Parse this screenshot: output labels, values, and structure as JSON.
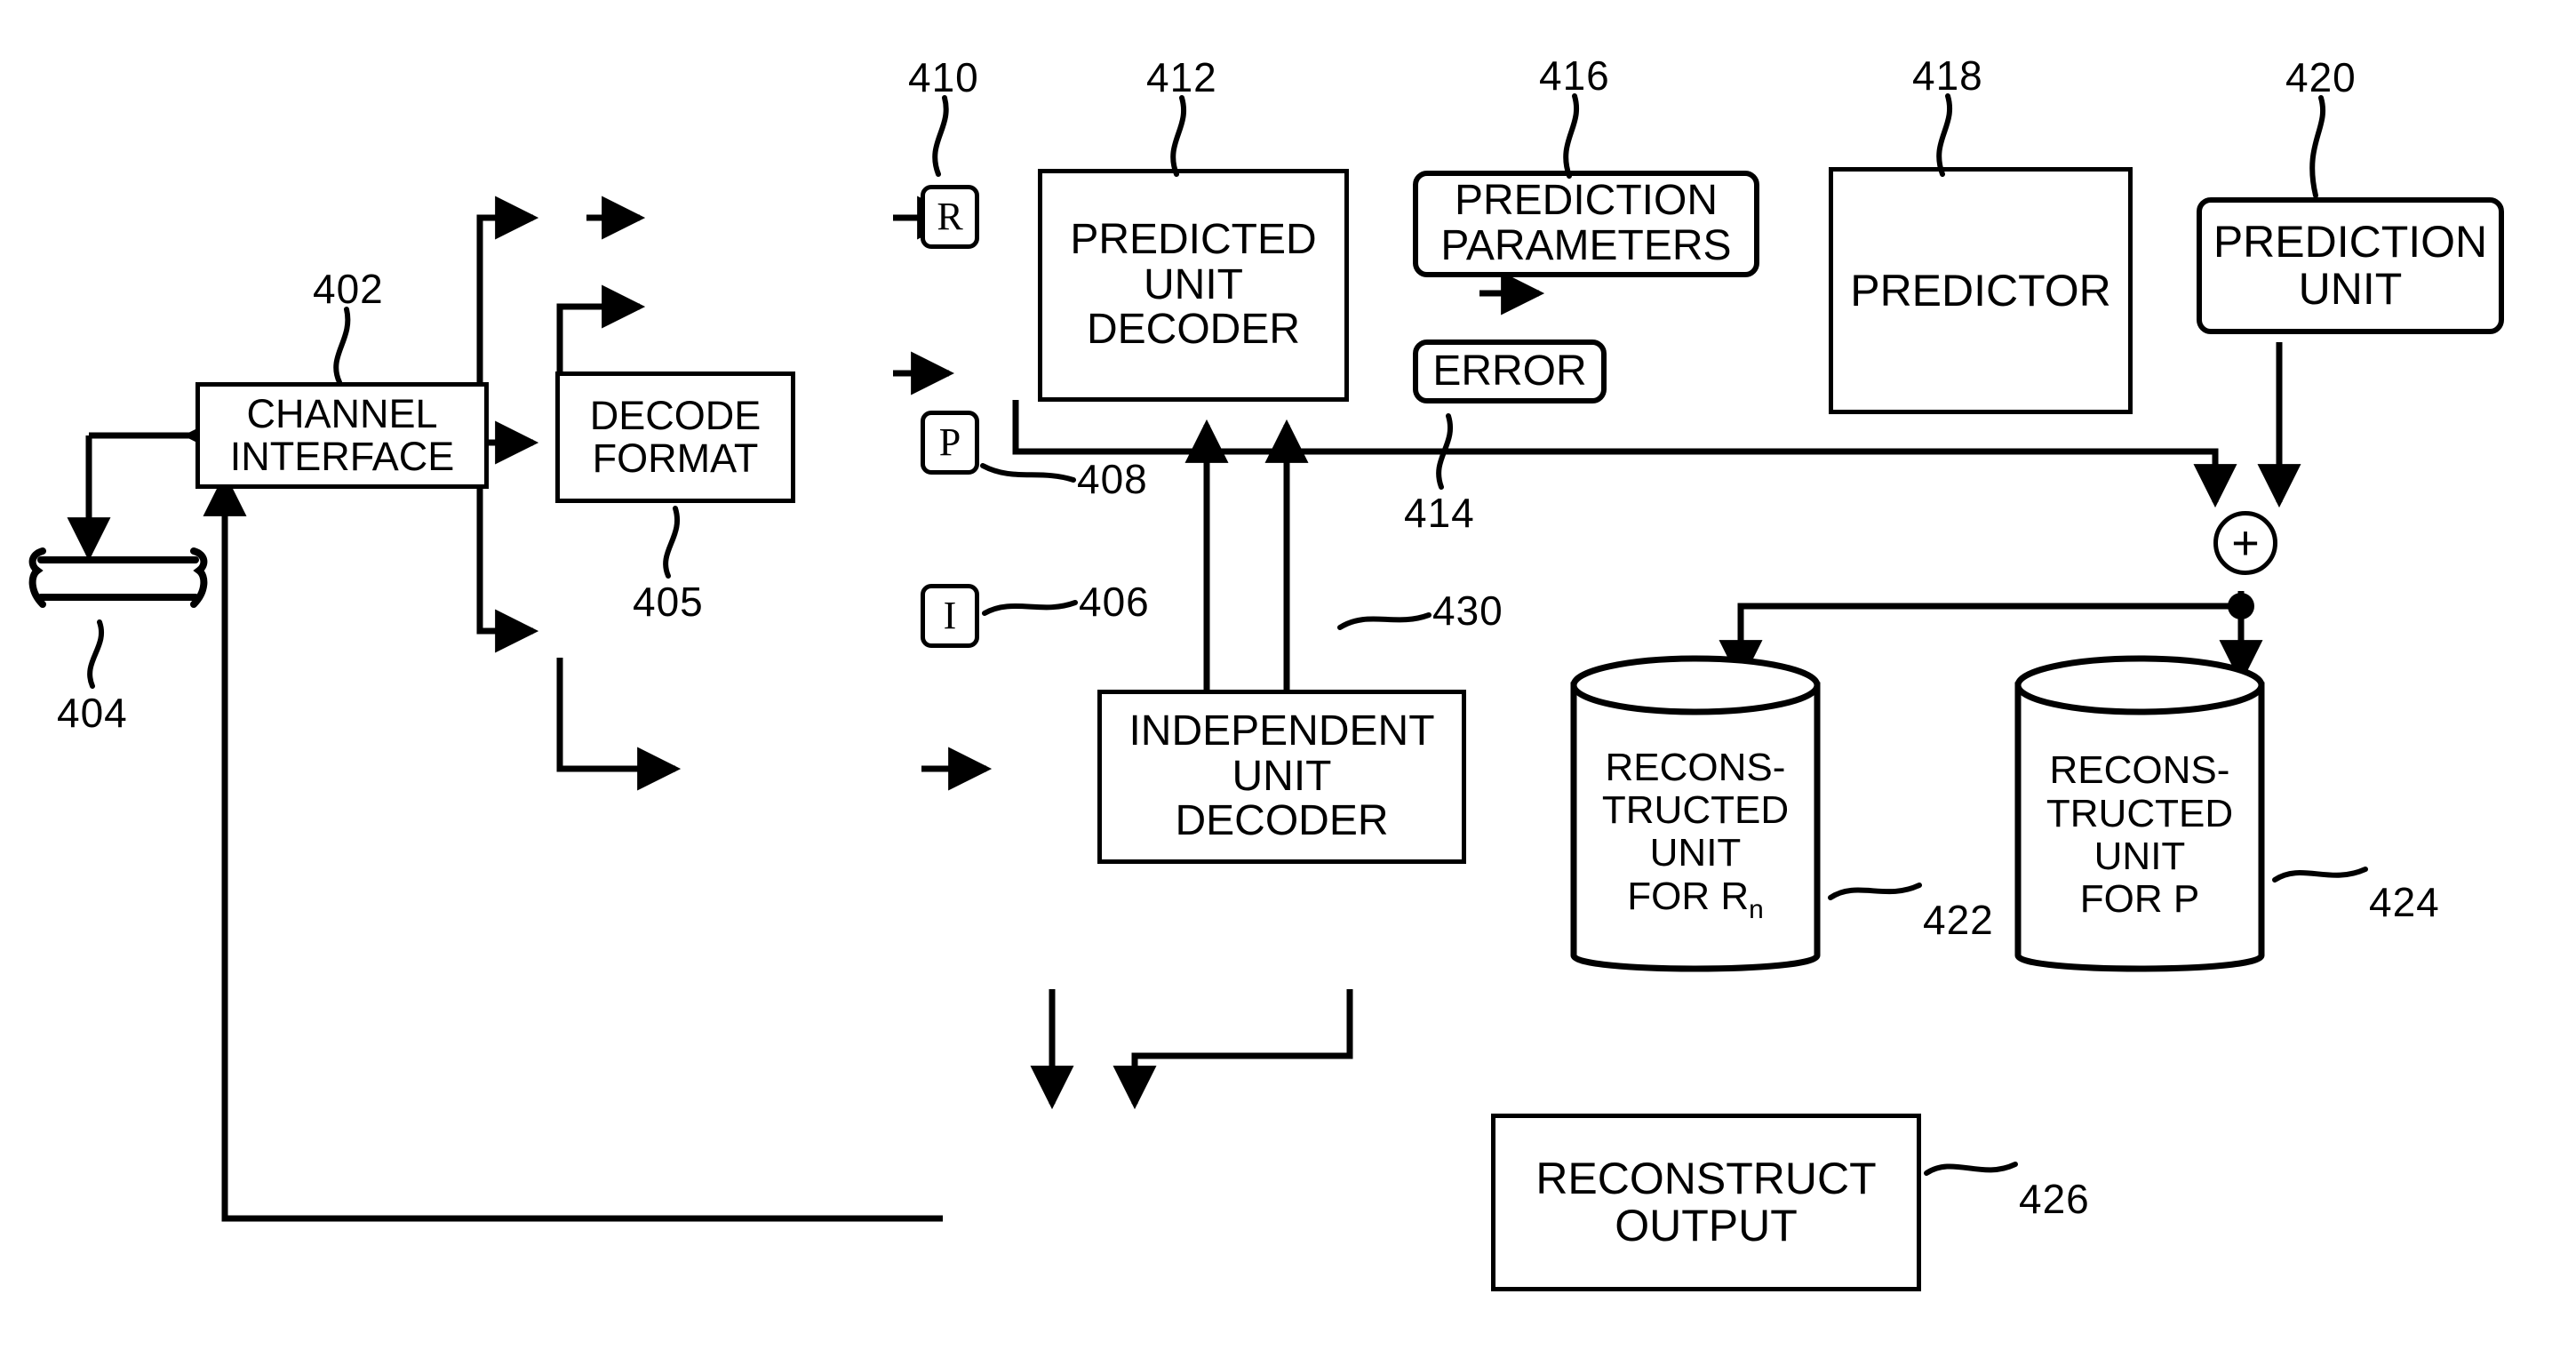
{
  "figure": {
    "type": "patent-block-diagram",
    "background": "#ffffff",
    "ink": "#000000"
  },
  "blocks": {
    "channel_interface": {
      "label": "CHANNEL\nINTERFACE",
      "ref": "402"
    },
    "channel_medium": {
      "label": "",
      "ref": "404"
    },
    "decode_format": {
      "label": "DECODE\nFORMAT",
      "ref": "405"
    },
    "node_r": {
      "label": "R",
      "ref": "410"
    },
    "node_p": {
      "label": "P",
      "ref": "408"
    },
    "node_i": {
      "label": "I",
      "ref": "406"
    },
    "predicted_unit_decoder": {
      "label": "PREDICTED\nUNIT\nDECODER",
      "ref": "412"
    },
    "prediction_parameters": {
      "label": "PREDICTION\nPARAMETERS",
      "ref": "416"
    },
    "error": {
      "label": "ERROR",
      "ref": "414"
    },
    "predictor": {
      "label": "PREDICTOR",
      "ref": "418"
    },
    "prediction_unit": {
      "label": "PREDICTION\nUNIT",
      "ref": "420"
    },
    "summing_junction": {
      "label": "+",
      "ref": ""
    },
    "independent_unit_decoder": {
      "label": "INDEPENDENT\nUNIT\nDECODER",
      "ref": "430"
    },
    "reconstructed_unit_rn": {
      "line1": "RECONS-",
      "line2": "TRUCTED",
      "line3": "UNIT",
      "line4": "FOR R",
      "sub": "n",
      "ref": "422"
    },
    "reconstructed_unit_p": {
      "line1": "RECONS-",
      "line2": "TRUCTED",
      "line3": "UNIT",
      "line4": "FOR P",
      "sub": "",
      "ref": "424"
    },
    "reconstruct_output": {
      "label": "RECONSTRUCT\nOUTPUT",
      "ref": "426"
    }
  },
  "ref_labels": {
    "r402": "402",
    "r404": "404",
    "r405": "405",
    "r406": "406",
    "r408": "408",
    "r410": "410",
    "r412": "412",
    "r414": "414",
    "r416": "416",
    "r418": "418",
    "r420": "420",
    "r422": "422",
    "r424": "424",
    "r426": "426",
    "r430": "430"
  },
  "block_text": {
    "channel_interface_l1": "CHANNEL",
    "channel_interface_l2": "INTERFACE",
    "decode_format_l1": "DECODE",
    "decode_format_l2": "FORMAT",
    "pud_l1": "PREDICTED",
    "pud_l2": "UNIT",
    "pud_l3": "DECODER",
    "pp_l1": "PREDICTION",
    "pp_l2": "PARAMETERS",
    "error": "ERROR",
    "predictor": "PREDICTOR",
    "pu_l1": "PREDICTION",
    "pu_l2": "UNIT",
    "iud_l1": "INDEPENDENT",
    "iud_l2": "UNIT",
    "iud_l3": "DECODER",
    "ro_l1": "RECONSTRUCT",
    "ro_l2": "OUTPUT",
    "node_r": "R",
    "node_p": "P",
    "node_i": "I",
    "plus": "+",
    "cyl_a_l1": "RECONS-",
    "cyl_a_l2": "TRUCTED",
    "cyl_a_l3": "UNIT",
    "cyl_a_l4": "FOR R",
    "cyl_a_sub": "n",
    "cyl_b_l1": "RECONS-",
    "cyl_b_l2": "TRUCTED",
    "cyl_b_l3": "UNIT",
    "cyl_b_l4": "FOR P"
  }
}
